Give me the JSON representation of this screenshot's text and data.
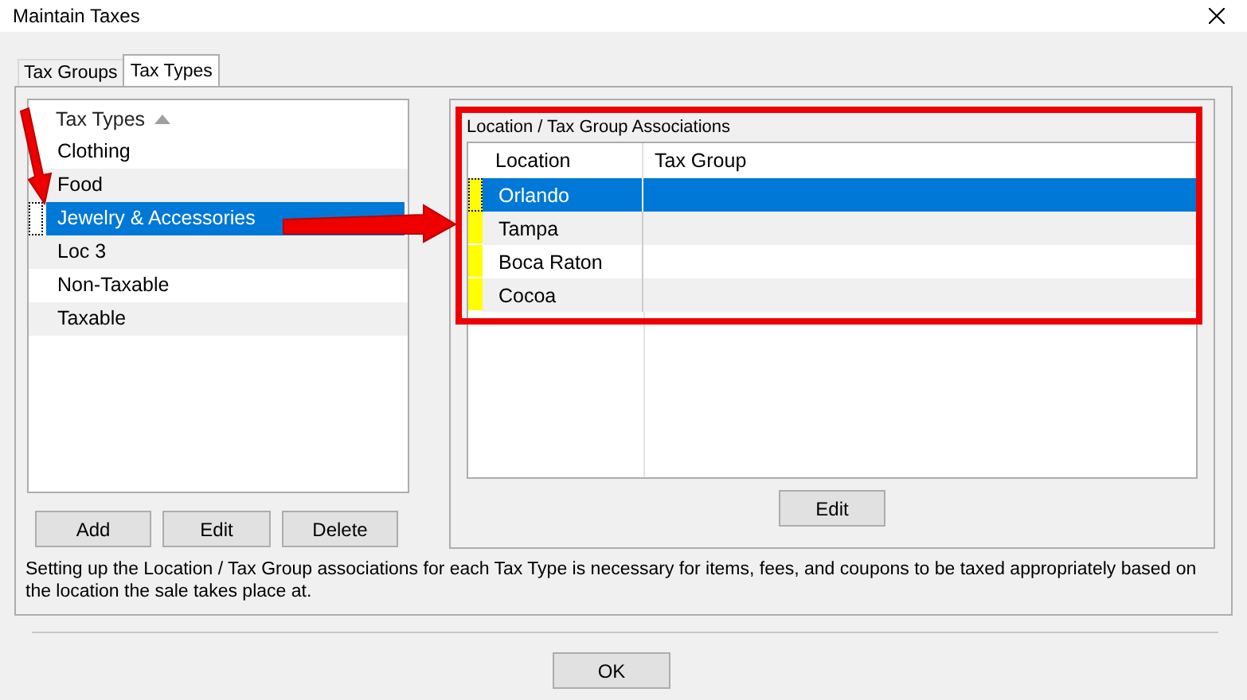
{
  "window": {
    "title": "Maintain Taxes"
  },
  "tabs": [
    {
      "label": "Tax Groups",
      "selected": false
    },
    {
      "label": "Tax Types",
      "selected": true
    }
  ],
  "tax_types": {
    "header": "Tax Types",
    "items": [
      {
        "label": "Clothing",
        "selected": false
      },
      {
        "label": "Food",
        "selected": false
      },
      {
        "label": "Jewelry & Accessories",
        "selected": true
      },
      {
        "label": "Loc 3",
        "selected": false
      },
      {
        "label": "Non-Taxable",
        "selected": false
      },
      {
        "label": "Taxable",
        "selected": false
      }
    ],
    "buttons": [
      "Add",
      "Edit",
      "Delete"
    ]
  },
  "associations": {
    "title": "Location / Tax Group Associations",
    "columns": [
      "Location",
      "Tax Group"
    ],
    "rows": [
      {
        "location": "Orlando",
        "selected": true
      },
      {
        "location": "Tampa",
        "selected": false
      },
      {
        "location": "Boca Raton",
        "selected": false
      },
      {
        "location": "Cocoa",
        "selected": false
      }
    ],
    "button": "Edit"
  },
  "description": "Setting up the Location / Tax Group associations for each Tax Type is necessary for items, fees, and coupons to be taxed appropriately based on the location the sale takes place at.",
  "ok_button": "OK"
}
